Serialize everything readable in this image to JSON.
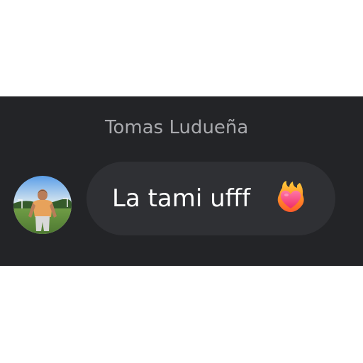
{
  "chat": {
    "sender_name": "Tomas Ludueña",
    "message_text": "La tami ufff",
    "emoji_icon": "heart-on-fire-icon",
    "avatar_icon": "profile-photo-avatar"
  },
  "colors": {
    "panel_background": "#232427",
    "bubble_background": "#2f3034",
    "sender_name_text": "#a8a9ad",
    "message_text": "#ffffff"
  }
}
